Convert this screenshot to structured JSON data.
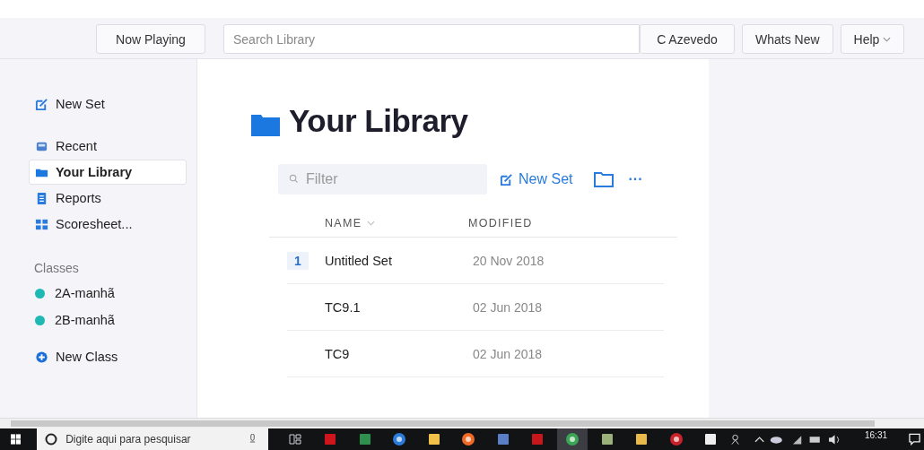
{
  "topbar": {
    "now_playing": "Now Playing",
    "search": {
      "placeholder": "Search Library"
    },
    "buttons": [
      {
        "label": "C Azevedo",
        "dropdown": false
      },
      {
        "label": "Whats New",
        "dropdown": false
      },
      {
        "label": "Help",
        "dropdown": true
      }
    ]
  },
  "sidebar": {
    "new_set": "New Set",
    "items": [
      {
        "label": "Recent",
        "kind": "recent",
        "selected": false
      },
      {
        "label": "Your Library",
        "kind": "library",
        "selected": true
      },
      {
        "label": "Reports",
        "kind": "reports",
        "selected": false
      },
      {
        "label": "Scoresheet...",
        "kind": "scoresheet",
        "selected": false
      }
    ],
    "classes_heading": "Classes",
    "classes": [
      {
        "label": "2A-manhã",
        "color": "#1fb8b3"
      },
      {
        "label": "2B-manhã",
        "color": "#1fb8b3"
      }
    ],
    "new_class": "New Class"
  },
  "main": {
    "title": "Your Library",
    "filter": {
      "placeholder": "Filter"
    },
    "new_set": "New Set",
    "more": "···",
    "table": {
      "columns": [
        {
          "label": "NAME",
          "sortable": true
        },
        {
          "label": "MODIFIED",
          "sortable": false
        }
      ],
      "rows": [
        {
          "badge": "1",
          "name": "Untitled Set",
          "modified": "20 Nov 2018"
        },
        {
          "name": "TC9.1",
          "modified": "02 Jun 2018"
        },
        {
          "name": "TC9",
          "modified": "02 Jun 2018"
        }
      ]
    }
  },
  "taskbar": {
    "search": {
      "placeholder": "Digite aqui para pesquisar"
    },
    "apps": [
      {
        "kind": "tasks",
        "selected": false
      },
      {
        "kind": "letter",
        "selected": false
      },
      {
        "kind": "sheet",
        "selected": false
      },
      {
        "kind": "browser",
        "selected": false
      },
      {
        "kind": "folder",
        "selected": false
      },
      {
        "kind": "fox",
        "selected": false
      },
      {
        "kind": "doc",
        "selected": false
      },
      {
        "kind": "pdf",
        "selected": false
      },
      {
        "kind": "globe",
        "selected": true
      },
      {
        "kind": "palette",
        "selected": false
      },
      {
        "kind": "netfolder",
        "selected": false
      },
      {
        "kind": "power",
        "selected": false
      },
      {
        "kind": "image",
        "selected": false
      }
    ],
    "time": "16:31"
  }
}
